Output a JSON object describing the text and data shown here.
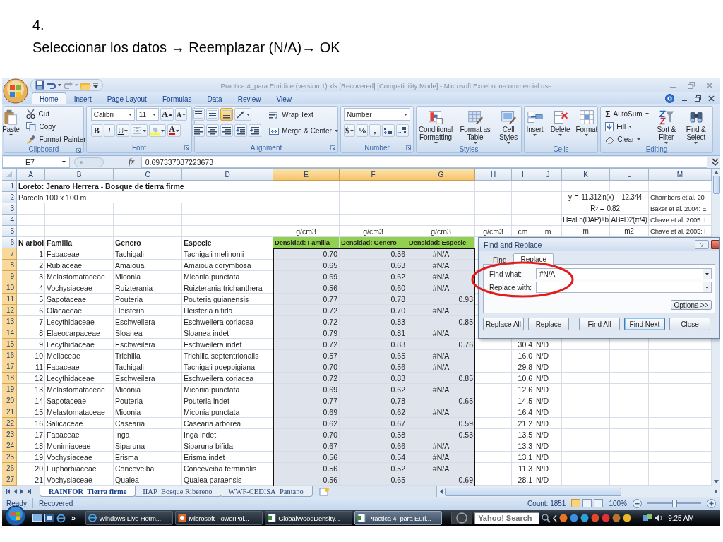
{
  "slide": {
    "step": "4.",
    "instruction": "Seleccionar los datos → Reemplazar  (N/A)→ OK"
  },
  "window": {
    "title": "Practica 4_para Euridice (version 1).xls [Recovered]  [Compatibility Mode] - Microsoft Excel non-commercial use"
  },
  "ribbon_tabs": [
    {
      "label": "Home",
      "selected": true
    },
    {
      "label": "Insert",
      "selected": false
    },
    {
      "label": "Page Layout",
      "selected": false
    },
    {
      "label": "Formulas",
      "selected": false
    },
    {
      "label": "Data",
      "selected": false
    },
    {
      "label": "Review",
      "selected": false
    },
    {
      "label": "View",
      "selected": false
    }
  ],
  "ribbon": {
    "groups": [
      {
        "label": "Clipboard",
        "controls": [
          {
            "label": "Paste"
          },
          {
            "label": "Cut"
          },
          {
            "label": "Copy"
          },
          {
            "label": "Format Painter"
          }
        ]
      },
      {
        "label": "Font",
        "controls": [
          {
            "value": "Calibri"
          },
          {
            "value": "11"
          },
          {
            "label": "A"
          },
          {
            "label": "A"
          },
          {
            "label": "B"
          },
          {
            "label": "I"
          },
          {
            "label": "U"
          },
          {
            "label": "A"
          }
        ]
      },
      {
        "label": "Alignment",
        "controls": [
          {
            "selected": false
          },
          {
            "selected": false
          },
          {
            "selected": true
          },
          {
            "label": "Wrap Text"
          },
          {
            "label": "Merge & Center"
          }
        ]
      },
      {
        "label": "Number",
        "controls": [
          {
            "value": "Number"
          },
          {
            "label": "$"
          },
          {
            "label": "%"
          },
          {
            "label": ","
          }
        ]
      },
      {
        "label": "Styles",
        "controls": [
          {
            "label": "Conditional Formatting"
          },
          {
            "label": "Format as Table"
          },
          {
            "label": "Cell Styles"
          }
        ]
      },
      {
        "label": "Cells",
        "controls": [
          {
            "label": "Insert"
          },
          {
            "label": "Delete"
          },
          {
            "label": "Format"
          }
        ]
      },
      {
        "label": "Editing",
        "controls": [
          {
            "glyph": "Σ",
            "label": "AutoSum"
          },
          {
            "label": "Fill"
          },
          {
            "label": "Clear"
          },
          {
            "label": "Sort & Filter"
          },
          {
            "label": "Find & Select"
          }
        ]
      }
    ]
  },
  "formula_bar": {
    "name_box": "E7",
    "function_label": "fx",
    "value": "0.697337087223673"
  },
  "sheet": {
    "columns": [
      {
        "label": "A",
        "kind": "id",
        "selected": false
      },
      {
        "label": "B",
        "kind": "text",
        "selected": false
      },
      {
        "label": "C",
        "kind": "text",
        "selected": false
      },
      {
        "label": "D",
        "kind": "text",
        "selected": false
      },
      {
        "label": "E",
        "kind": "number",
        "selected": true
      },
      {
        "label": "F",
        "kind": "number",
        "selected": true
      },
      {
        "label": "G",
        "kind": "number",
        "selected": true
      },
      {
        "label": "H",
        "kind": "number",
        "selected": false
      },
      {
        "label": "I",
        "kind": "number",
        "selected": false
      },
      {
        "label": "J",
        "kind": "code",
        "selected": false
      },
      {
        "label": "K",
        "kind": "formula",
        "selected": false
      },
      {
        "label": "L",
        "kind": "formula",
        "selected": false
      },
      {
        "label": "M",
        "kind": "reference",
        "selected": false
      }
    ],
    "rows": [
      {
        "header": "1",
        "kind": "title",
        "selected": false,
        "cells": [
          "Loreto: Jenaro Herrera - Bosque de tierra firme",
          null,
          null,
          null,
          null,
          null,
          null,
          null,
          null,
          null,
          null,
          null,
          null
        ]
      },
      {
        "header": "2",
        "kind": "note",
        "selected": false,
        "cells": [
          "Parcela 100 x 100 m",
          null,
          null,
          null,
          null,
          null,
          null,
          null,
          null,
          null,
          "y = 11.312ln(x) - 12.344",
          null,
          "Chambers et al. 20"
        ]
      },
      {
        "header": "3",
        "kind": "note",
        "selected": false,
        "cells": [
          null,
          null,
          null,
          null,
          null,
          null,
          null,
          null,
          null,
          null,
          "R$^{2}$ = 0.82",
          null,
          "Baker et al. 2004: E"
        ]
      },
      {
        "header": "4",
        "kind": "note",
        "selected": false,
        "cells": [
          null,
          null,
          null,
          null,
          null,
          null,
          null,
          null,
          null,
          null,
          "H=aLn(DAP)±b",
          "AB=D2(π/4)",
          "Chave et al. 2005: I"
        ]
      },
      {
        "header": "5",
        "kind": "units",
        "selected": false,
        "cells": [
          null,
          null,
          null,
          null,
          "g/cm3",
          "g/cm3",
          "g/cm3",
          "g/cm3",
          "cm",
          "m",
          "m",
          "m2",
          "Chave et al. 2005: I"
        ]
      },
      {
        "header": "6",
        "kind": "header",
        "selected": false,
        "cells": [
          "N arbol",
          "Familia",
          "Genero",
          "Especie",
          {
            "text": "Densidad: Familia",
            "color": "#92d050"
          },
          {
            "text": "Densidad: Genero",
            "color": "#92d050"
          },
          {
            "text": "Densidad: Especie",
            "color": "#92d050"
          },
          null,
          null,
          null,
          null,
          null,
          null
        ]
      },
      {
        "header": "7",
        "kind": "data",
        "selected": true,
        "cells": [
          "1",
          "Fabaceae",
          "Tachigali",
          "Tachigali melinonii",
          "0.70",
          "0.56",
          {
            "text": "#N/A",
            "kind": "error"
          },
          null,
          null,
          null,
          null,
          null,
          null
        ]
      },
      {
        "header": "8",
        "kind": "data",
        "selected": true,
        "cells": [
          "2",
          "Rubiaceae",
          "Amaioua",
          "Amaioua corymbosa",
          "0.65",
          "0.63",
          {
            "text": "#N/A",
            "kind": "error"
          },
          null,
          null,
          null,
          null,
          null,
          null
        ]
      },
      {
        "header": "9",
        "kind": "data",
        "selected": true,
        "cells": [
          "3",
          "Melastomataceae",
          "Miconia",
          "Miconia punctata",
          "0.69",
          "0.62",
          {
            "text": "#N/A",
            "kind": "error"
          },
          null,
          null,
          null,
          null,
          null,
          null
        ]
      },
      {
        "header": "10",
        "kind": "data",
        "selected": true,
        "cells": [
          "4",
          "Vochysiaceae",
          "Ruizterania",
          "Ruizterania trichanthera",
          "0.56",
          "0.60",
          {
            "text": "#N/A",
            "kind": "error"
          },
          null,
          null,
          null,
          null,
          null,
          null
        ]
      },
      {
        "header": "11",
        "kind": "data",
        "selected": true,
        "cells": [
          "5",
          "Sapotaceae",
          "Pouteria",
          "Pouteria guianensis",
          "0.77",
          "0.78",
          "0.93",
          null,
          null,
          null,
          null,
          null,
          null
        ]
      },
      {
        "header": "12",
        "kind": "data",
        "selected": true,
        "cells": [
          "6",
          "Olacaceae",
          "Heisteria",
          "Heisteria nitida",
          "0.72",
          "0.70",
          {
            "text": "#N/A",
            "kind": "error"
          },
          null,
          null,
          null,
          null,
          null,
          null
        ]
      },
      {
        "header": "13",
        "kind": "data",
        "selected": true,
        "cells": [
          "7",
          "Lecythidaceae",
          "Eschweilera",
          "Eschweilera coriacea",
          "0.72",
          "0.83",
          "0.85",
          null,
          null,
          null,
          null,
          null,
          null
        ]
      },
      {
        "header": "14",
        "kind": "data",
        "selected": true,
        "cells": [
          "8",
          "Elaeocarpaceae",
          "Sloanea",
          "Sloanea indet",
          "0.79",
          "0.81",
          {
            "text": "#N/A",
            "kind": "error"
          },
          null,
          null,
          null,
          null,
          null,
          null
        ]
      },
      {
        "header": "15",
        "kind": "data",
        "selected": true,
        "cells": [
          "9",
          "Lecythidaceae",
          "Eschweilera",
          "Eschweilera indet",
          "0.72",
          "0.83",
          "0.76",
          null,
          "30.4",
          "N/D",
          null,
          null,
          null
        ]
      },
      {
        "header": "16",
        "kind": "data",
        "selected": true,
        "cells": [
          "10",
          "Meliaceae",
          "Trichilia",
          "Trichilia septentrionalis",
          "0.57",
          "0.65",
          {
            "text": "#N/A",
            "kind": "error"
          },
          null,
          "16.0",
          "N/D",
          null,
          null,
          null
        ]
      },
      {
        "header": "17",
        "kind": "data",
        "selected": true,
        "cells": [
          "11",
          "Fabaceae",
          "Tachigali",
          "Tachigali poeppigiana",
          "0.70",
          "0.56",
          {
            "text": "#N/A",
            "kind": "error"
          },
          null,
          "29.8",
          "N/D",
          null,
          null,
          null
        ]
      },
      {
        "header": "18",
        "kind": "data",
        "selected": true,
        "cells": [
          "12",
          "Lecythidaceae",
          "Eschweilera",
          "Eschweilera coriacea",
          "0.72",
          "0.83",
          "0.85",
          null,
          "10.6",
          "N/D",
          null,
          null,
          null
        ]
      },
      {
        "header": "19",
        "kind": "data",
        "selected": true,
        "cells": [
          "13",
          "Melastomataceae",
          "Miconia",
          "Miconia punctata",
          "0.69",
          "0.62",
          {
            "text": "#N/A",
            "kind": "error"
          },
          null,
          "12.6",
          "N/D",
          null,
          null,
          null
        ]
      },
      {
        "header": "20",
        "kind": "data",
        "selected": true,
        "cells": [
          "14",
          "Sapotaceae",
          "Pouteria",
          "Pouteria indet",
          "0.77",
          "0.78",
          "0.65",
          null,
          "14.5",
          "N/D",
          null,
          null,
          null
        ]
      },
      {
        "header": "21",
        "kind": "data",
        "selected": true,
        "cells": [
          "15",
          "Melastomataceae",
          "Miconia",
          "Miconia punctata",
          "0.69",
          "0.62",
          {
            "text": "#N/A",
            "kind": "error"
          },
          null,
          "16.4",
          "N/D",
          null,
          null,
          null
        ]
      },
      {
        "header": "22",
        "kind": "data",
        "selected": true,
        "cells": [
          "16",
          "Salicaceae",
          "Casearia",
          "Casearia arborea",
          "0.62",
          "0.67",
          "0.59",
          null,
          "21.2",
          "N/D",
          null,
          null,
          null
        ]
      },
      {
        "header": "23",
        "kind": "data",
        "selected": true,
        "cells": [
          "17",
          "Fabaceae",
          "Inga",
          "Inga indet",
          "0.70",
          "0.58",
          "0.53",
          null,
          "13.5",
          "N/D",
          null,
          null,
          null
        ]
      },
      {
        "header": "24",
        "kind": "data",
        "selected": true,
        "cells": [
          "18",
          "Monimiaceae",
          "Siparuna",
          "Siparuna bifida",
          "0.67",
          "0.66",
          {
            "text": "#N/A",
            "kind": "error"
          },
          null,
          "13.3",
          "N/D",
          null,
          null,
          null
        ]
      },
      {
        "header": "25",
        "kind": "data",
        "selected": true,
        "cells": [
          "19",
          "Vochysiaceae",
          "Erisma",
          "Erisma indet",
          "0.56",
          "0.54",
          {
            "text": "#N/A",
            "kind": "error"
          },
          null,
          "13.1",
          "N/D",
          null,
          null,
          null
        ]
      },
      {
        "header": "26",
        "kind": "data",
        "selected": true,
        "cells": [
          "20",
          "Euphorbiaceae",
          "Conceveiba",
          "Conceveiba terminalis",
          "0.56",
          "0.52",
          {
            "text": "#N/A",
            "kind": "error"
          },
          null,
          "11.3",
          "N/D",
          null,
          null,
          null
        ]
      },
      {
        "header": "27",
        "kind": "data",
        "selected": true,
        "cells": [
          "21",
          "Vochysiaceae",
          "Qualea",
          "Qualea paraensis",
          "0.56",
          "0.65",
          "0.69",
          null,
          "28.1",
          "N/D",
          null,
          null,
          null
        ]
      }
    ]
  },
  "dialog": {
    "title": "Find and Replace",
    "help": "?",
    "tabs": [
      {
        "label": "Find",
        "selected": false
      },
      {
        "label": "Replace",
        "selected": true
      }
    ],
    "fields": [
      {
        "label": "Find what:",
        "value": "#N/A"
      },
      {
        "label": "Replace with:"
      }
    ],
    "options_button": "Options >>",
    "buttons": [
      {
        "label": "Replace All",
        "default": false
      },
      {
        "label": "Replace",
        "default": false
      },
      {
        "label": "Find All",
        "default": false
      },
      {
        "label": "Find Next",
        "default": true
      },
      {
        "label": "Close",
        "default": false
      }
    ]
  },
  "sheet_tabs": [
    {
      "label": "RAINFOR_Tierra firme",
      "selected": true
    },
    {
      "label": "IIAP_Bosque Ribereno",
      "selected": false
    },
    {
      "label": "WWF-CEDISA_Pantano",
      "selected": false
    }
  ],
  "status_bar": {
    "mode": "Ready",
    "info": "Recovered",
    "count": "Count: 1851",
    "views": [
      {
        "selected": true
      },
      {
        "selected": false
      },
      {
        "selected": false
      }
    ],
    "zoom": "100%",
    "zoom_slider": {
      "level": 0.5
    }
  },
  "taskbar": {
    "overflow": "»",
    "tasks": [
      {
        "label": "Windows Live Hotm...",
        "kind": "browser",
        "selected": false
      },
      {
        "label": "Microsoft PowerPoi...",
        "kind": "presentation",
        "selected": false
      },
      {
        "label": "GlobalWoodDensity...",
        "kind": "spreadsheet",
        "selected": false
      },
      {
        "label": "Practica 4_para Euri...",
        "kind": "spreadsheet",
        "selected": true
      }
    ],
    "search": {
      "placeholder": "Yahoo! Search"
    },
    "clock": "9:25 AM"
  }
}
